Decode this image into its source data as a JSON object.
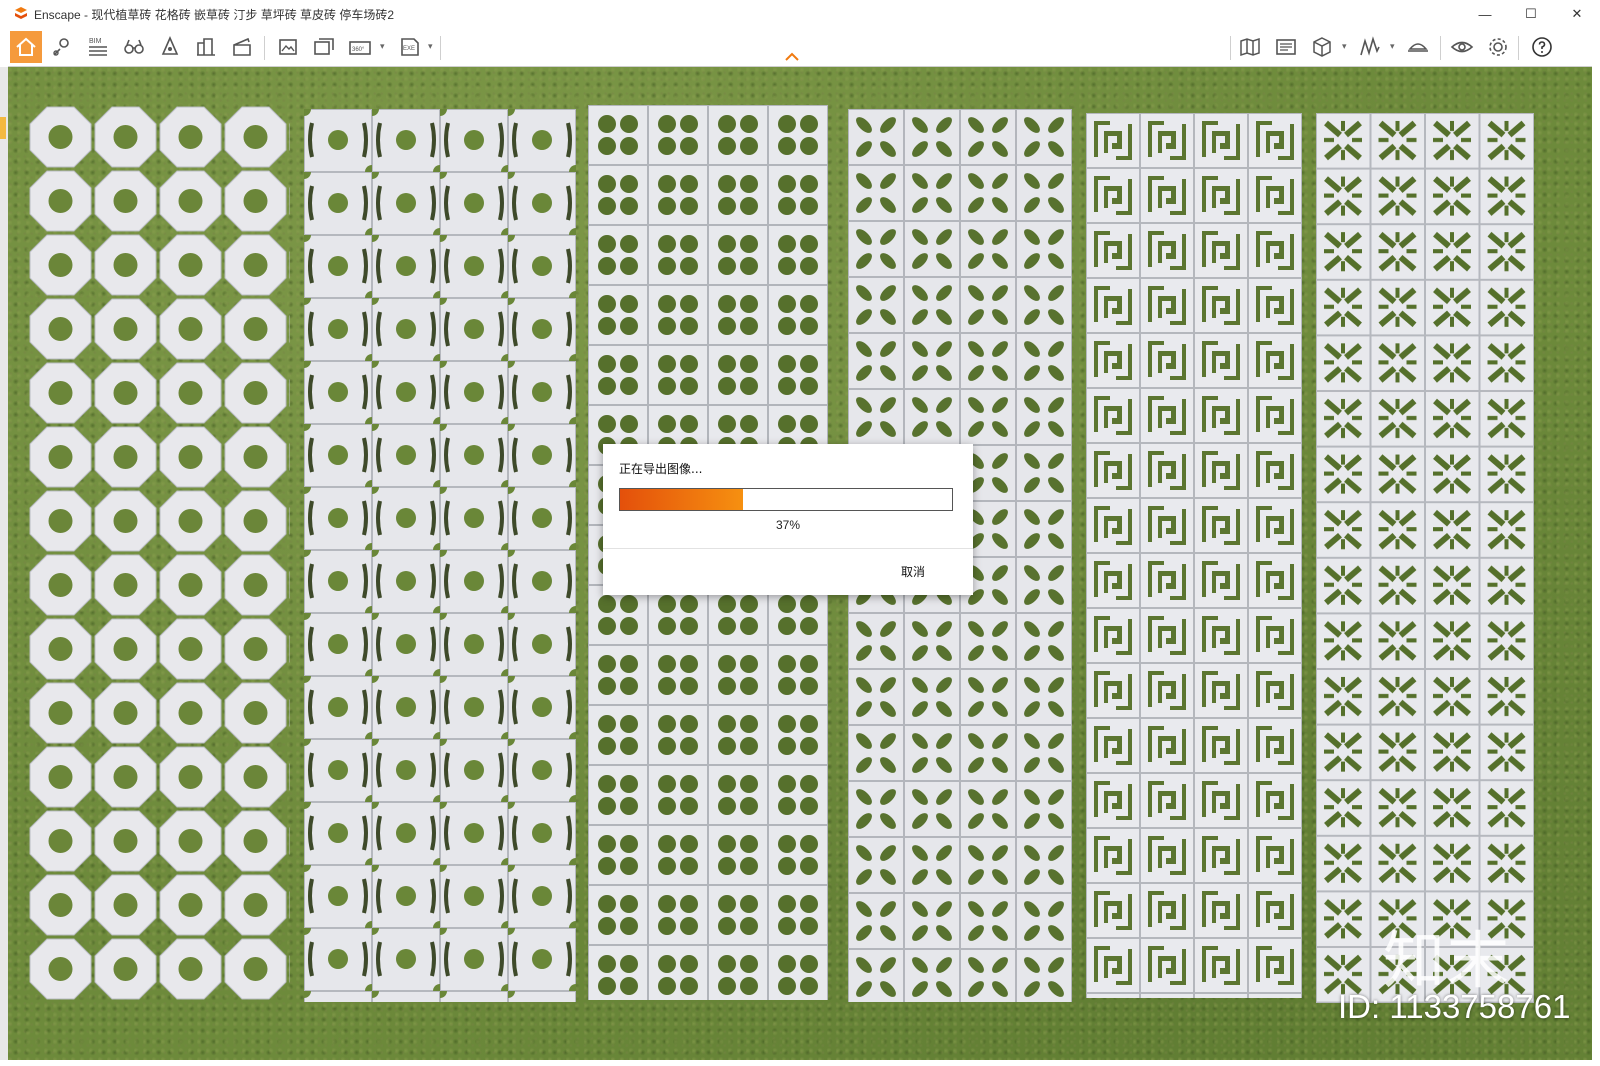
{
  "window": {
    "title": "Enscape - 现代植草砖 花格砖 嵌草砖 汀步 草坪砖 草皮砖 停车场砖2",
    "minimize": "—",
    "maximize": "☐",
    "close": "✕"
  },
  "toolbar": {
    "bim_label": "BIM",
    "export_exe_label": "EXE",
    "view_360_label": "360°",
    "buttons": [
      "home-icon",
      "map-pin-icon",
      "bim-icon",
      "binoculars-icon",
      "cone-icon",
      "buildings-icon",
      "clapperboard-icon",
      "export-image-icon",
      "batch-render-icon",
      "panorama-icon",
      "export-exe-icon",
      "map-icon",
      "gallery-icon",
      "cube-icon",
      "graph-icon",
      "hat-icon",
      "eye-icon",
      "gear-icon",
      "help-icon"
    ],
    "active_button": "home-icon",
    "accent": "#f59a3c"
  },
  "viewport": {
    "scene": "paving tile strips on grass",
    "grass_color": "#6d8a3b",
    "tile_color": "#e9e9ee"
  },
  "watermark": {
    "logo_text": "知末",
    "id_text": "ID: 1133758761"
  },
  "dialog": {
    "title": "正在导出图像...",
    "progress_percent": 37,
    "progress_text": "37%",
    "cancel_label": "取消",
    "progress_colors": [
      "#e4500b",
      "#f69010"
    ]
  }
}
